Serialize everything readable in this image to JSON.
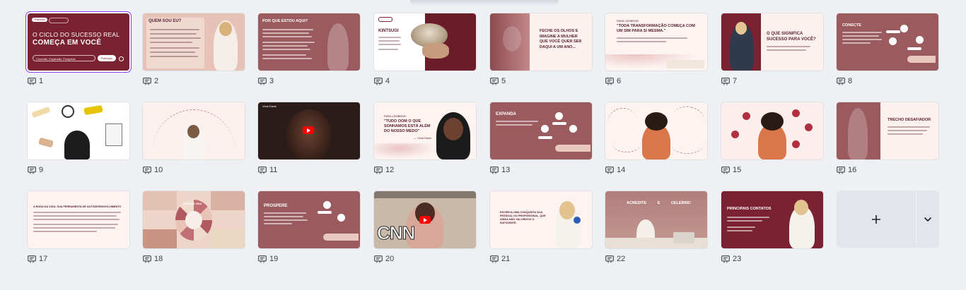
{
  "slides": [
    {
      "number": "1",
      "title": "O CICLO DO SUCESSO REAL",
      "subtitle": "COMEÇA EM VOCÊ",
      "input": "Conexão. Expansão. Prosperar",
      "cta": "Participe!",
      "tag": "Palestra"
    },
    {
      "number": "2",
      "title": "QUEM SOU EU?"
    },
    {
      "number": "3",
      "title": "POR QUE ESTOU AQUI?"
    },
    {
      "number": "4",
      "title": "KINTSUGI"
    },
    {
      "number": "5",
      "title": "FECHE OS OLHOS E IMAGINE A MULHER QUE VOCÊ QUER SER DAQUI A UM ANO..."
    },
    {
      "number": "6",
      "kicker": "PARA LEMBRAR:",
      "title": "\"TODA TRANSFORMAÇÃO COMEÇA COM UM SIM PARA SI MESMA.\""
    },
    {
      "number": "7",
      "title": "O QUE SIGNIFICA SUCESSO PARA VOCÊ?"
    },
    {
      "number": "8",
      "title": "CONECTE"
    },
    {
      "number": "9"
    },
    {
      "number": "10"
    },
    {
      "number": "11",
      "video_title": "Viola Davis"
    },
    {
      "number": "12",
      "kicker": "PARA LEMBRAR:",
      "title": "\"TUDO OOM O QUE SONHAMOS ESTÁ ALÉM DO NOSSO MEDO\"",
      "author": "— Viola Davis"
    },
    {
      "number": "13",
      "title": "EXPANDA"
    },
    {
      "number": "14"
    },
    {
      "number": "15"
    },
    {
      "number": "16",
      "title": "TRECHO DESAFIADOR"
    },
    {
      "number": "17",
      "title": "A RODA DA VIDA: SUA FERRAMENTA DE AUTODESENVOLVIMENTO"
    },
    {
      "number": "18",
      "title": "RODA DA VIDA"
    },
    {
      "number": "19",
      "title": "PROSPERE"
    },
    {
      "number": "20",
      "logo": "CNN"
    },
    {
      "number": "21",
      "title": "ESCREVA UMA CONQUISTA SUA, PESSOAL OU PROFISSIONAL, QUE AINDA NÃO VALORIZOU O SUFICIENTE."
    },
    {
      "number": "22",
      "title": "ACREDITE E CELEBRE!"
    },
    {
      "number": "23",
      "title": "PRINCIPAIS CONTATOS"
    }
  ],
  "add_slide_icon": "plus-icon",
  "add_menu_icon": "chevron-down-icon",
  "note_icon": "presenter-notes-icon",
  "colors": {
    "burgundy": "#7a2231",
    "rose": "#9b5b5e",
    "blush": "#f7ebe8",
    "accent": "#8b3dff"
  }
}
